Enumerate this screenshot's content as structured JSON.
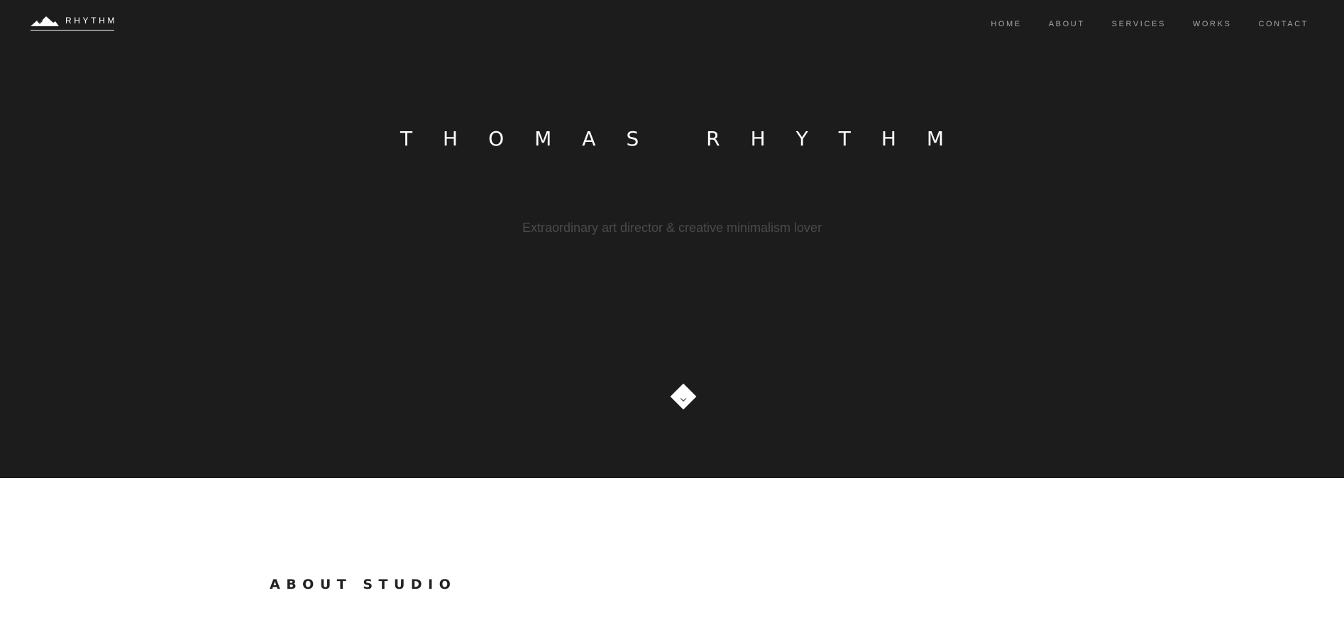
{
  "header": {
    "logo_text": "RHYTHM",
    "logo_icon": "mountain-icon",
    "nav": [
      {
        "label": "HOME"
      },
      {
        "label": "ABOUT"
      },
      {
        "label": "SERVICES"
      },
      {
        "label": "WORKS"
      },
      {
        "label": "CONTACT"
      }
    ]
  },
  "hero": {
    "title": "THOMAS RHYTHM",
    "subtitle": "Extraordinary art director & creative minimalism lover",
    "scroll_icon": "chevron-down-icon"
  },
  "about": {
    "heading": "ABOUT STUDIO"
  },
  "colors": {
    "hero_bg": "#1c1c1c",
    "page_bg": "#ffffff",
    "nav_text": "#a9a9a9",
    "subtitle_text": "#4a4a4a"
  }
}
